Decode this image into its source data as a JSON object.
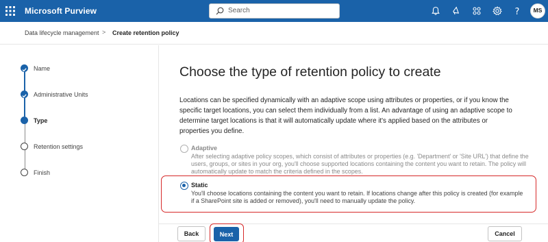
{
  "app": {
    "title": "Microsoft Purview"
  },
  "search": {
    "placeholder": "Search"
  },
  "user": {
    "initials": "MS"
  },
  "breadcrumb": {
    "parent": "Data lifecycle management",
    "separator": ">",
    "current": "Create retention policy"
  },
  "steps": [
    {
      "label": "Name",
      "state": "done"
    },
    {
      "label": "Administrative Units",
      "state": "done"
    },
    {
      "label": "Type",
      "state": "current"
    },
    {
      "label": "Retention settings",
      "state": "todo"
    },
    {
      "label": "Finish",
      "state": "todo"
    }
  ],
  "main": {
    "title": "Choose the type of retention policy to create",
    "intro_lines": [
      "Locations can be specified dynamically with an adaptive scope using attributes or properties, or if you know the",
      "specific target locations, you can select them individually from a list. An advantage of using an adaptive scope to",
      "determine target locations is that it will automatically update where it's applied based on the attributes or",
      "properties you define."
    ],
    "options": {
      "adaptive": {
        "title": "Adaptive",
        "selected": false,
        "lines": [
          "After selecting adaptive policy scopes, which consist of attributes or properties (e.g. 'Department' or 'Site URL') that define the",
          "users, groups, or sites in your org, you'll choose supported locations containing the content you want to retain. The policy will",
          "automatically update to match the criteria defined in the scopes."
        ]
      },
      "static": {
        "title": "Static",
        "selected": true,
        "lines": [
          "You'll choose locations containing the content you want to retain. If locations change after this policy is created (for example",
          "if a SharePoint site is added or removed), you'll need to manually update the policy."
        ]
      }
    }
  },
  "footer": {
    "back_label": "Back",
    "next_label": "Next",
    "cancel_label": "Cancel"
  },
  "colors": {
    "brand": "#1a62a9",
    "highlight": "#d62828"
  },
  "icons": [
    "waffle-icon",
    "search-icon",
    "bell-icon",
    "megaphone-icon",
    "share-icon",
    "gear-icon",
    "help-icon",
    "chevron-right-icon"
  ]
}
